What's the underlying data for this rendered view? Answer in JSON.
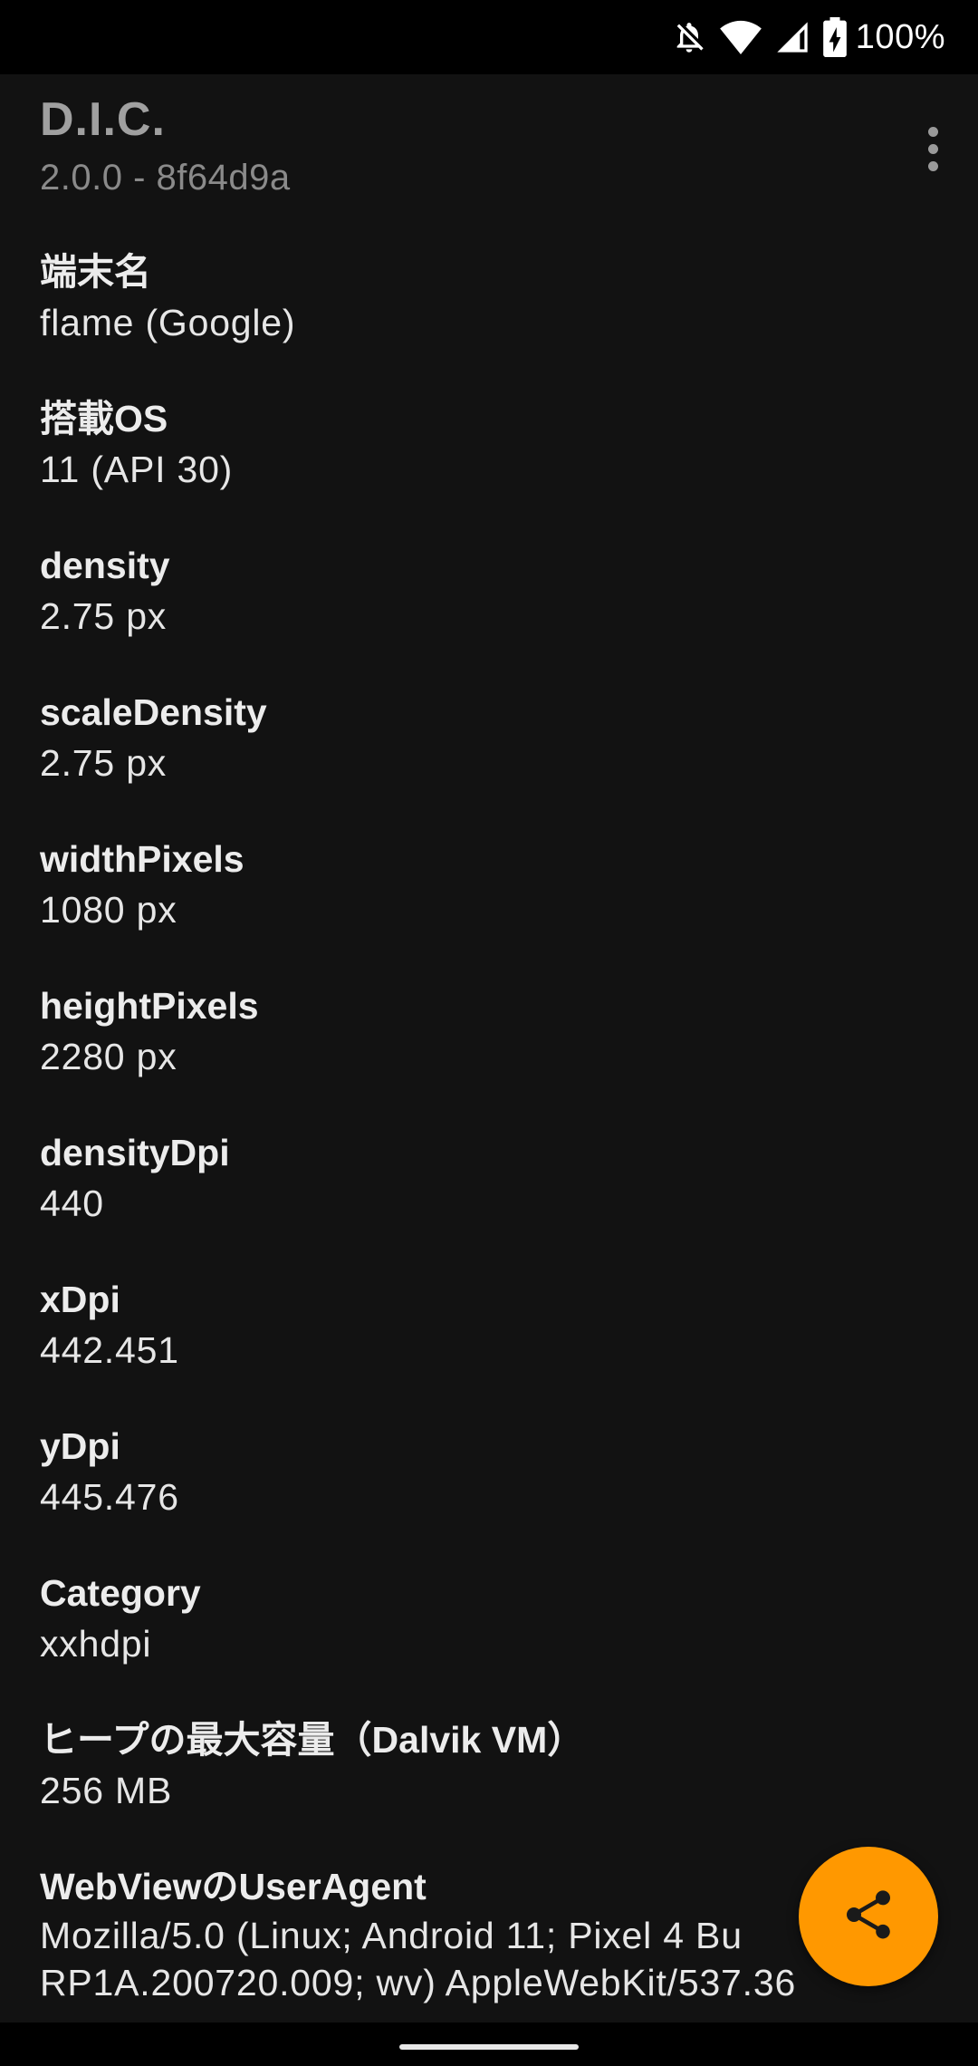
{
  "status_bar": {
    "battery_text": "100%",
    "icons": [
      "notifications-off-icon",
      "wifi-icon",
      "cellular-signal-icon",
      "battery-charging-icon"
    ]
  },
  "header": {
    "title": "D.I.C.",
    "subtitle": "2.0.0 - 8f64d9a",
    "overflow_icon": "more-vert-icon"
  },
  "items": [
    {
      "label": "端末名",
      "value": "flame (Google)"
    },
    {
      "label": "搭載OS",
      "value": "11 (API 30)"
    },
    {
      "label": "density",
      "value": "2.75 px"
    },
    {
      "label": "scaleDensity",
      "value": "2.75 px"
    },
    {
      "label": "widthPixels",
      "value": "1080 px"
    },
    {
      "label": "heightPixels",
      "value": "2280 px"
    },
    {
      "label": "densityDpi",
      "value": "440"
    },
    {
      "label": "xDpi",
      "value": "442.451"
    },
    {
      "label": "yDpi",
      "value": "445.476"
    },
    {
      "label": "Category",
      "value": "xxhdpi"
    },
    {
      "label": "ヒープの最大容量（Dalvik VM）",
      "value": "256 MB"
    },
    {
      "label": "WebViewのUserAgent",
      "value_line1": "Mozilla/5.0 (Linux; Android 11; Pixel 4 Bu",
      "value_line2": "RP1A.200720.009; wv) AppleWebKit/537.36"
    }
  ],
  "fab": {
    "icon": "share-icon",
    "color": "#ff9800"
  },
  "colors": {
    "background": "#121212",
    "status_bar": "#000000",
    "accent": "#ff9800"
  }
}
